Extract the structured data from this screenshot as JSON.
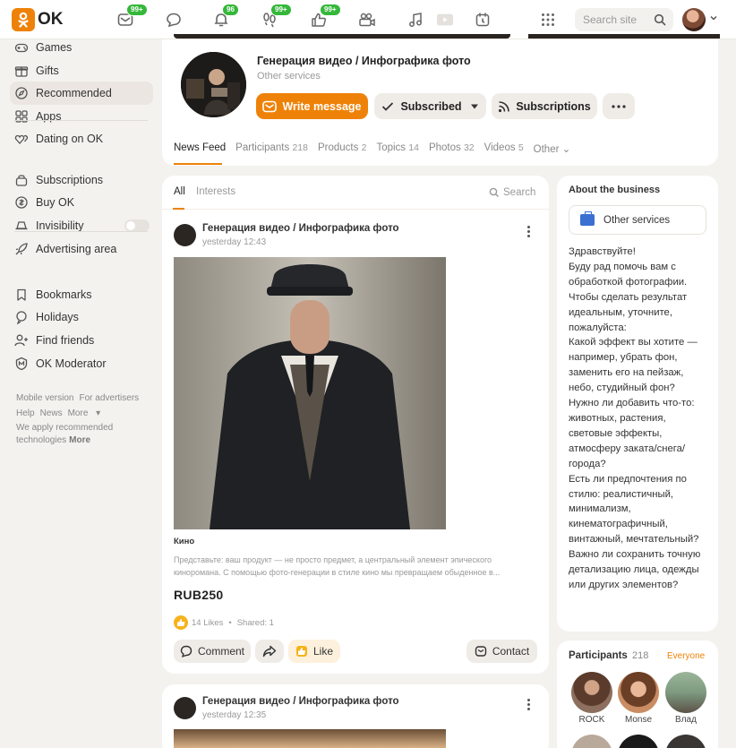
{
  "topbar": {
    "logo_text": "OK",
    "badges": {
      "messages": "99+",
      "notifications": "96",
      "guests": "99+",
      "likes": "99+"
    },
    "search_placeholder": "Search site"
  },
  "sidebar": {
    "items": [
      {
        "label": "Games",
        "icon": "gamepad-icon"
      },
      {
        "label": "Gifts",
        "icon": "gift-icon"
      },
      {
        "label": "Recommended",
        "icon": "compass-icon"
      },
      {
        "label": "Apps",
        "icon": "apps-grid-icon"
      },
      {
        "label": "Dating on OK",
        "icon": "hearts-icon"
      },
      {
        "label": "Subscriptions",
        "icon": "lock-bag-icon"
      },
      {
        "label": "Buy OK",
        "icon": "coin-icon"
      },
      {
        "label": "Invisibility",
        "icon": "invisibility-icon"
      },
      {
        "label": "Advertising area",
        "icon": "rocket-icon"
      },
      {
        "label": "Bookmarks",
        "icon": "bookmark-icon"
      },
      {
        "label": "Holidays",
        "icon": "holiday-icon"
      },
      {
        "label": "Find friends",
        "icon": "add-friend-icon"
      },
      {
        "label": "OK Moderator",
        "icon": "moderator-icon"
      }
    ],
    "footer": {
      "mobile": "Mobile version",
      "advertisers": "For advertisers",
      "help": "Help",
      "news": "News",
      "more": "More",
      "tech_text": "We apply recommended technologies",
      "tech_more": "More"
    }
  },
  "group": {
    "name": "Генерация видео / Инфографика фото",
    "category": "Other services",
    "write_message": "Write message",
    "subscribed": "Subscribed",
    "subscriptions": "Subscriptions",
    "tabs": [
      {
        "label": "News Feed",
        "count": ""
      },
      {
        "label": "Participants",
        "count": "218"
      },
      {
        "label": "Products",
        "count": "2"
      },
      {
        "label": "Topics",
        "count": "14"
      },
      {
        "label": "Photos",
        "count": "32"
      },
      {
        "label": "Videos",
        "count": "5"
      },
      {
        "label": "Other",
        "count": ""
      }
    ]
  },
  "feed": {
    "tab_all": "All",
    "tab_interests": "Interests",
    "search_label": "Search",
    "posts": [
      {
        "author": "Генерация видео / Инфографика фото",
        "time": "yesterday 12:43",
        "product_name": "Кино",
        "description": "Представьте: ваш продукт — не просто предмет, а центральный элемент эпического кинoромана. С помощью фото-генерации в стиле кино мы превращаем обыденное в...",
        "price": "RUB250",
        "likes": "14 Likes",
        "shared": "Shared: 1",
        "comment_label": "Comment",
        "like_label": "Like",
        "contact_label": "Contact"
      },
      {
        "author": "Генерация видео / Инфографика фото",
        "time": "yesterday 12:35"
      }
    ]
  },
  "about": {
    "title": "About the business",
    "service_button": "Other services",
    "text": "Здравствуйте!\nБуду рад помочь вам с обработкой фотографии. Чтобы сделать результат идеальным, уточните, пожалуйста:\n Какой эффект вы хотите — например, убрать фон, заменить его на пейзаж, небо, студийный фон?\n Нужно ли добавить что-то: животных, растения, световые эффекты, атмосферу заката/снега/города?\n Есть ли предпочтения по стилю: реалистичный, минимализм, кинематографичный, винтажный, мечтательный?\n Важно ли сохранить точную детализацию лица, одежды или других элементов?"
  },
  "participants": {
    "title": "Participants",
    "count": "218",
    "everyone": "Everyone",
    "people": [
      {
        "name": "ROCK"
      },
      {
        "name": "Monse"
      },
      {
        "name": "Влад"
      }
    ]
  },
  "colors": {
    "accent": "#ee8208",
    "badge": "#35b73a",
    "background": "#f4f2ef"
  }
}
